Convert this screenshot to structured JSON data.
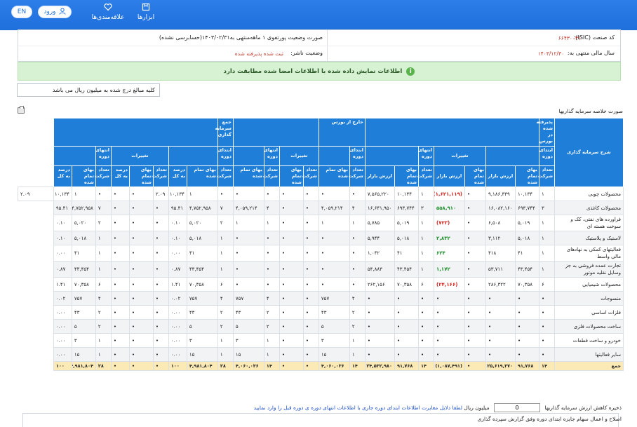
{
  "topbar": {
    "lang": "EN",
    "login": "ورود",
    "favorites": "علاقه‌مندی‌ها",
    "tools": "ابزارها",
    "user_icon": "user-icon",
    "heart_icon": "heart-icon",
    "tools_icon": "toolbox-icon"
  },
  "info": {
    "isic_label": "کد صنعت (ISIC):",
    "isic_value": "۶۶۴۳۰۰۳۱",
    "report_label": "صورت وضعیت پورتفوی ۱ ماهه‌منتهی به۱۴۰۳/۰۲/۳۱(حسابرسی نشده)",
    "fiscal_label": "سال مالی منتهی به:",
    "fiscal_value": "۱۴۰۳/۱۲/۳۰",
    "publisher_label": "وضعیت ناشر:",
    "publisher_value": "ثبت شده پذیرفته شده"
  },
  "alert": {
    "text": "اطلاعات نمایش داده شده با اطلاعات امضا شده مطابقت دارد"
  },
  "unit_note": "کلیه مبالغ درج شده به میلیون ریال می باشد",
  "section_title": "صورت خلاصه سرمایه گذاریها",
  "table": {
    "head": {
      "desc": "شرح سرمایه گذاری",
      "accepted": "پذیرفته شده در بورس",
      "opening": "ابتدای دوره",
      "changes": "تغییرات",
      "closing": "انتهای دوره",
      "exit": "خارج از بورس",
      "total_inv": "جمع سرمایه گذاری",
      "count": "تعداد شرکت",
      "cost": "بهای تمام شده",
      "market": "ارزش بازار",
      "pct": "درصد به کل"
    },
    "rows": [
      {
        "name": "محصولات چوبی",
        "c": [
          "۱",
          "۱۰,۱۳۴",
          "۹,۱۸۶,۳۳۹",
          "•",
          "(۱,۶۲۱,۱۱۹)",
          "۱",
          "۱۰,۱۳۴",
          "۷,۵۶۵,۲۲۰",
          "•",
          "•",
          "•",
          "•",
          "•",
          "•",
          "•",
          "۱",
          "۱۰,۱۳۴",
          "۲.۰۹",
          "•",
          "•",
          "•",
          "۱",
          "۱۰,۱۳۴",
          "۲.۰۹"
        ]
      },
      {
        "name": "محصولات کاغذی",
        "c": [
          "۳",
          "۶۹۳,۷۴۴",
          "۱۶,۰۸۲,۱۶۰",
          "•",
          "۵۵۸,۹۱۰",
          "۳",
          "۶۹۳,۷۴۴",
          "۱۶,۶۴۱,۹۵۰",
          "۴",
          "۴,۰۵۹,۲۱۴",
          "•",
          "•",
          "۴",
          "۴,۰۵۹,۲۱۴",
          "۷",
          "۴,۷۵۲,۹۵۸",
          "۹۵.۴۱",
          "•",
          "•",
          "•",
          "۷",
          "۴,۷۵۲,۹۵۸",
          "۹۵.۴۱"
        ]
      },
      {
        "name": "فراورده های نفتی، کک و سوخت هسته ای",
        "c": [
          "۱",
          "۵,۰۱۹",
          "۶,۵۰۸",
          "•",
          "(۷۲۳)",
          "۱",
          "۵,۰۱۹",
          "۵,۷۸۵",
          "۱",
          "۱",
          "•",
          "•",
          "۱",
          "۱",
          "۲",
          "۵,۰۲۰",
          "۰.۱۰",
          "•",
          "•",
          "•",
          "۲",
          "۵,۰۲۰",
          "۰.۱۰"
        ]
      },
      {
        "name": "لاستیک و پلاستیک",
        "c": [
          "۱",
          "۵,۰۱۸",
          "۳,۱۱۲",
          "•",
          "۲,۸۳۲",
          "۱",
          "۵,۰۱۸",
          "۵,۹۴۴",
          "•",
          "•",
          "•",
          "•",
          "•",
          "•",
          "۱",
          "۵,۰۱۸",
          "۰.۱۰",
          "•",
          "•",
          "•",
          "۱",
          "۵,۰۱۸",
          "۰.۱۰"
        ]
      },
      {
        "name": "فعالیتهای کمکی به نهادهای مالی واسط",
        "c": [
          "۱",
          "۴۱",
          "۴۱۸",
          "•",
          "۶۲۴",
          "۱",
          "۴۱",
          "۱,۰۴۲",
          "•",
          "•",
          "•",
          "•",
          "•",
          "•",
          "۱",
          "۴۱",
          "۰.۰۰",
          "•",
          "•",
          "•",
          "۱",
          "۴۱",
          "۰.۰۰"
        ]
      },
      {
        "name": "تجارت عمده فروشی به جز وسایل نقلیه موتور",
        "c": [
          "۱",
          "۴۳,۴۵۴",
          "۵۳,۷۱۱",
          "•",
          "۱,۱۷۲",
          "۱",
          "۴۳,۴۵۴",
          "۵۴,۸۸۳",
          "•",
          "•",
          "•",
          "•",
          "•",
          "•",
          "۱",
          "۴۳,۴۵۴",
          "۰.۸۷",
          "•",
          "•",
          "•",
          "۱",
          "۴۳,۴۵۴",
          "۰.۸۷"
        ]
      },
      {
        "name": "محصولات شیمیایی",
        "c": [
          "۶",
          "۷۰,۳۵۸",
          "۲۸۶,۳۲۲",
          "•",
          "(۲۴,۱۶۶)",
          "۶",
          "۷۰,۳۵۸",
          "۲۶۲,۱۵۶",
          "•",
          "•",
          "•",
          "•",
          "•",
          "•",
          "۶",
          "۷۰,۳۵۸",
          "۱.۴۱",
          "•",
          "•",
          "•",
          "۶",
          "۷۰,۳۵۸",
          "۱.۴۱"
        ]
      },
      {
        "name": "منسوجات",
        "c": [
          "•",
          "•",
          "•",
          "•",
          "•",
          "•",
          "•",
          "•",
          "۴",
          "۷۵۷",
          "•",
          "•",
          "۴",
          "۷۵۷",
          "۴",
          "۷۵۷",
          "۰.۰۲",
          "•",
          "•",
          "•",
          "۴",
          "۷۵۷",
          "۰.۰۲"
        ]
      },
      {
        "name": "فلزات اساسی",
        "c": [
          "•",
          "•",
          "•",
          "•",
          "•",
          "•",
          "•",
          "•",
          "۲",
          "۴۳",
          "•",
          "•",
          "۲",
          "۴۳",
          "۲",
          "۴۳",
          "۰.۰۰",
          "•",
          "•",
          "•",
          "۲",
          "۴۳",
          "۰.۰۰"
        ]
      },
      {
        "name": "ساخت محصولات فلزی",
        "c": [
          "•",
          "•",
          "•",
          "•",
          "•",
          "•",
          "•",
          "•",
          "۲",
          "۵",
          "•",
          "•",
          "۲",
          "۵",
          "۲",
          "۵",
          "۰.۰۰",
          "•",
          "•",
          "•",
          "۲",
          "۵",
          "۰.۰۰"
        ]
      },
      {
        "name": "خودرو و ساخت قطعات",
        "c": [
          "•",
          "•",
          "•",
          "•",
          "•",
          "•",
          "•",
          "•",
          "۱",
          "۳",
          "•",
          "•",
          "۱",
          "۳",
          "۱",
          "۳",
          "۰.۰۰",
          "•",
          "•",
          "•",
          "۱",
          "۳",
          "۰.۰۰"
        ]
      },
      {
        "name": "سایر فعالیتها",
        "c": [
          "•",
          "•",
          "•",
          "•",
          "•",
          "•",
          "•",
          "•",
          "۱",
          "۱۵",
          "•",
          "•",
          "۱",
          "۱۵",
          "۱",
          "۱۵",
          "۰.۰۰",
          "•",
          "•",
          "•",
          "۱",
          "۱۵",
          "۰.۰۰"
        ]
      }
    ],
    "total": {
      "name": "جمع",
      "c": [
        "۱۴",
        "۹۱,۷۶۸",
        "۲۵,۶۱۹,۳۷۰",
        "•",
        "(۱,۰۸۷,۴۹۱)",
        "۱۴",
        "۹۱,۷۶۸",
        "۲۴,۵۳۲,۹۸۰",
        "۱۴",
        "۴,۰۶۰,۰۳۶",
        "•",
        "•",
        "۱۴",
        "۴,۰۶۰,۰۳۶",
        "۲۸",
        "۴,۹۸۱,۸۰۴",
        "۱۰۰",
        "•",
        "•",
        "•",
        "۲۸",
        "۴,۹۸۱,۸۰۴",
        "۱۰۰"
      ]
    }
  },
  "footer": {
    "reserve_label": "ذخیره کاهش ارزش سرمایه گذاریها",
    "reserve_value": "0",
    "reserve_unit": "میلیون ریال",
    "reserve_note": "لطفا دلایل مغایرت اطلاعات ابتدای دوره جاری با اطلاعات انتهای دوره ی دوره قبل را وارد نمایید",
    "amend_note": "اصلاح و اعمال سهام جایزه ابتدای دوره وفق گزارش سپرده گذاری"
  }
}
